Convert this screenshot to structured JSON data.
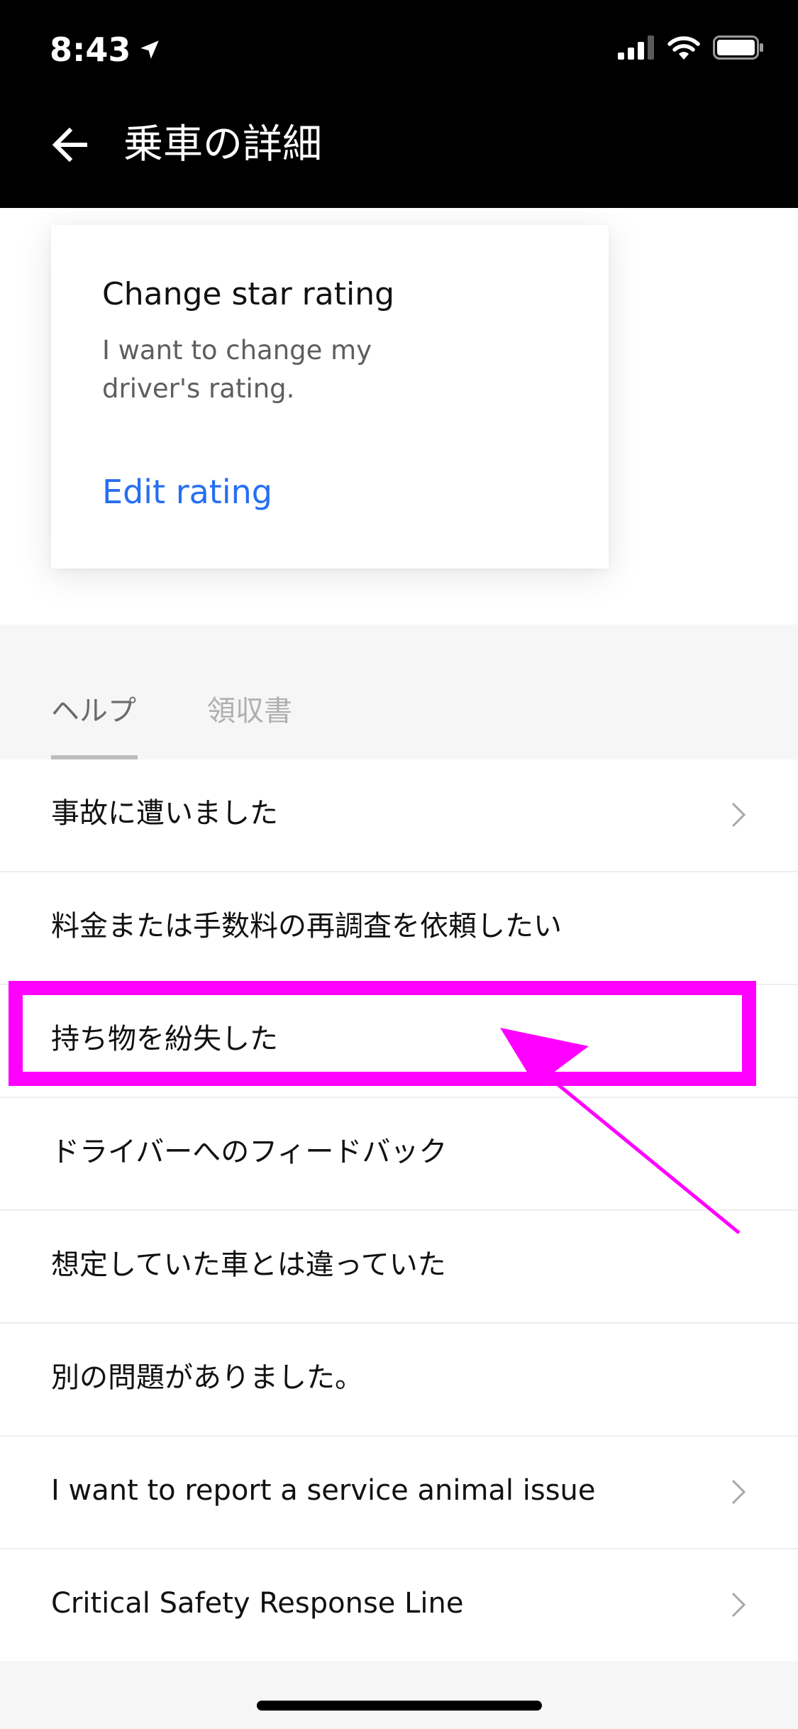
{
  "status_bar": {
    "time": "8:43"
  },
  "header": {
    "title": "乗車の詳細"
  },
  "card": {
    "title": "Change star rating",
    "body": "I want to change my driver's rating.",
    "link": "Edit rating"
  },
  "tabs": [
    {
      "label": "ヘルプ",
      "selected": true
    },
    {
      "label": "領収書",
      "selected": false
    }
  ],
  "help_items": [
    {
      "label": "事故に遭いました",
      "chevron": true
    },
    {
      "label": "料金または手数料の再調査を依頼したい",
      "chevron": false
    },
    {
      "label": "持ち物を紛失した",
      "chevron": false,
      "highlighted": true
    },
    {
      "label": "ドライバーへのフィードバック",
      "chevron": false
    },
    {
      "label": "想定していた車とは違っていた",
      "chevron": false
    },
    {
      "label": "別の問題がありました。",
      "chevron": false
    },
    {
      "label": "I want to report a service animal issue",
      "chevron": true
    },
    {
      "label": "Critical Safety Response Line",
      "chevron": true
    }
  ],
  "colors": {
    "header_bg": "#000000",
    "link": "#276ef1",
    "annotation": "#ff00ff",
    "tab_bar_bg": "#f6f6f6"
  },
  "icons": {
    "back": "arrow-left-icon",
    "location": "location-arrow-icon",
    "signal": "cellular-signal-icon",
    "wifi": "wifi-icon",
    "battery": "battery-icon",
    "row_chevron": "chevron-right-icon"
  }
}
